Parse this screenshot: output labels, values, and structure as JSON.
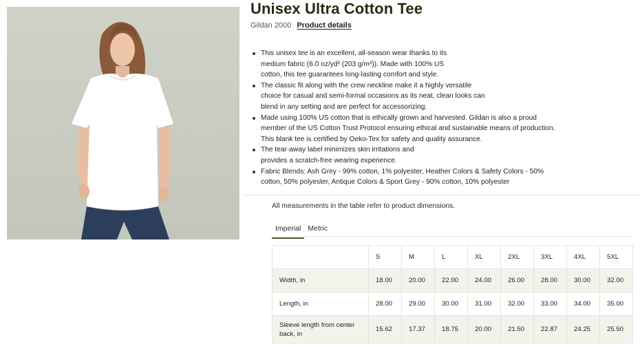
{
  "product": {
    "title": "Unisex Ultra Cotton Tee",
    "model": "Gildan 2000",
    "details_link": "Product details"
  },
  "bullets": [
    "This unisex tee is an excellent, all-season wear thanks to its medium fabric (6.0 oz/yd² (203 g/m²)). Made with 100% US cotton, this tee guarantees long-lasting comfort and style.",
    "The classic fit along with the crew neckline make it a highly versatile choice for casual and semi-formal occasions as its neat, clean looks can blend in any setting and are perfect for accessorizing.",
    "Made using 100% US cotton that is ethically grown and harvested. Gildan is also a proud member of the US Cotton Trust Protocol ensuring ethical and sustainable means of production. This blank tee is certified by Oeko-Tex for safety and quality assurance.",
    "The tear-away label minimizes skin irritations and provides a scratch-free wearing experience.",
    "Fabric Blends: Ash Grey - 99% cotton, 1% polyester, Heather Colors & Safety Colors - 50% cotton, 50% polyester, Antique Colors & Sport Grey - 90% cotton, 10% polyester"
  ],
  "measurements": {
    "note": "All measurements in the table refer to product dimensions.",
    "tabs": [
      "Imperial",
      "Metric"
    ],
    "active_tab": "Imperial",
    "sizes": [
      "S",
      "M",
      "L",
      "XL",
      "2XL",
      "3XL",
      "4XL",
      "5XL"
    ],
    "rows": [
      {
        "label": "Width, in",
        "values": [
          "18.00",
          "20.00",
          "22.00",
          "24.00",
          "26.00",
          "28.00",
          "30.00",
          "32.00"
        ]
      },
      {
        "label": "Length, in",
        "values": [
          "28.00",
          "29.00",
          "30.00",
          "31.00",
          "32.00",
          "33.00",
          "34.00",
          "35.00"
        ]
      },
      {
        "label": "Sleeve length from center back, in",
        "values": [
          "15.62",
          "17.37",
          "18.75",
          "20.00",
          "21.50",
          "22.87",
          "24.25",
          "25.50"
        ]
      }
    ]
  },
  "colors": {
    "title": "#2a2a14",
    "tab_underline": "#55552f",
    "row_shade": "#f3f3ec",
    "photo_bg": "#cbcec2",
    "shirt": "#ffffff",
    "jeans": "#2c3e5c"
  }
}
